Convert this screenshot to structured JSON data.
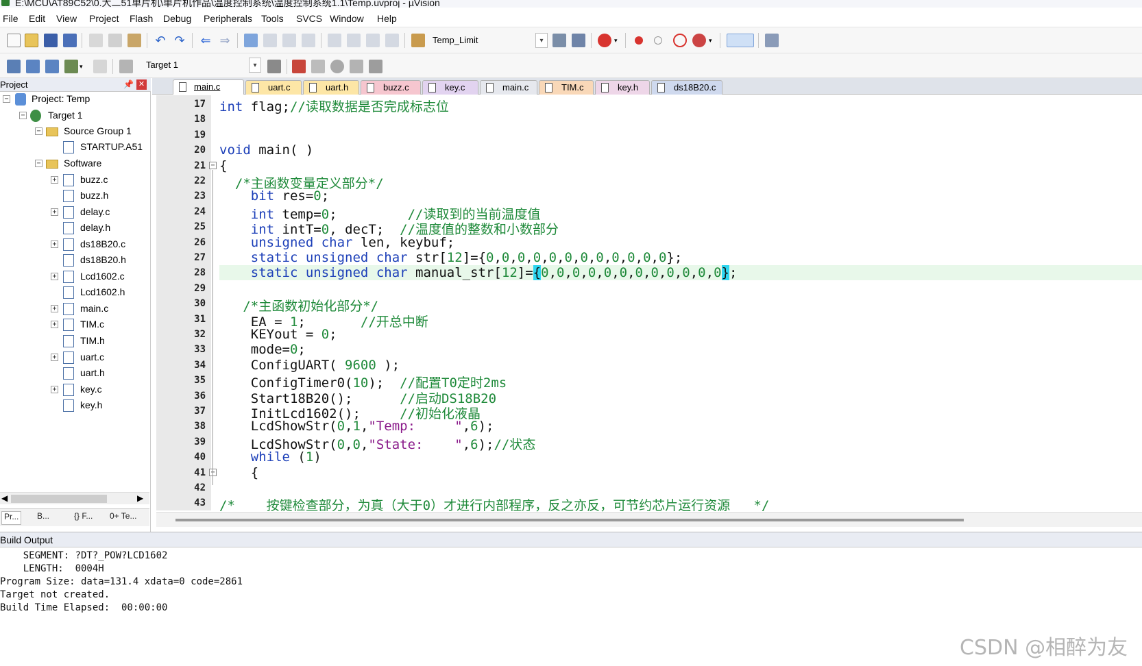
{
  "window": {
    "title": "E:\\MCU\\AT89C52\\0.大二51单片机\\单片机作品\\温度控制系统\\温度控制系统1.1\\Temp.uvproj - µVision"
  },
  "menu": [
    "File",
    "Edit",
    "View",
    "Project",
    "Flash",
    "Debug",
    "Peripherals",
    "Tools",
    "SVCS",
    "Window",
    "Help"
  ],
  "toolbar": {
    "find_combo": "Temp_Limit",
    "target_combo": "Target 1"
  },
  "project_panel": {
    "title": "Project",
    "pin_glyph": "📌",
    "close_glyph": "✕",
    "tree": [
      {
        "label": "Project: Temp",
        "kind": "project"
      },
      {
        "label": "Target 1",
        "kind": "target"
      },
      {
        "label": "Source Group 1",
        "kind": "folder"
      },
      {
        "label": "STARTUP.A51",
        "kind": "file"
      },
      {
        "label": "Software",
        "kind": "folder"
      },
      {
        "label": "buzz.c",
        "kind": "file"
      },
      {
        "label": "buzz.h",
        "kind": "file"
      },
      {
        "label": "delay.c",
        "kind": "file"
      },
      {
        "label": "delay.h",
        "kind": "file"
      },
      {
        "label": "ds18B20.c",
        "kind": "file"
      },
      {
        "label": "ds18B20.h",
        "kind": "file"
      },
      {
        "label": "Lcd1602.c",
        "kind": "file"
      },
      {
        "label": "Lcd1602.h",
        "kind": "file"
      },
      {
        "label": "main.c",
        "kind": "file"
      },
      {
        "label": "TIM.c",
        "kind": "file"
      },
      {
        "label": "TIM.h",
        "kind": "file"
      },
      {
        "label": "uart.c",
        "kind": "file"
      },
      {
        "label": "uart.h",
        "kind": "file"
      },
      {
        "label": "key.c",
        "kind": "file"
      },
      {
        "label": "key.h",
        "kind": "file"
      }
    ],
    "tabs": [
      "Pr...",
      "B...",
      "{} F...",
      "0+ Te..."
    ]
  },
  "editor_tabs": [
    {
      "label": "main.c",
      "color": "#ffffff",
      "active": true
    },
    {
      "label": "uart.c",
      "color": "#fde6a6"
    },
    {
      "label": "uart.h",
      "color": "#fde6a6"
    },
    {
      "label": "buzz.c",
      "color": "#f6c6cf"
    },
    {
      "label": "key.c",
      "color": "#e2d3f0"
    },
    {
      "label": "main.c",
      "color": "#e6e8ee"
    },
    {
      "label": "TIM.c",
      "color": "#f9d8b8"
    },
    {
      "label": "key.h",
      "color": "#eed6e8"
    },
    {
      "label": "ds18B20.c",
      "color": "#cfd9ee"
    }
  ],
  "code_lines": [
    {
      "n": "17",
      "text": "int flag;//读取数据是否完成标志位"
    },
    {
      "n": "18",
      "text": ""
    },
    {
      "n": "19",
      "text": ""
    },
    {
      "n": "20",
      "text": "void main( )"
    },
    {
      "n": "21",
      "text": "{"
    },
    {
      "n": "22",
      "text": "  /*主函数变量定义部分*/"
    },
    {
      "n": "23",
      "text": "    bit res=0;"
    },
    {
      "n": "24",
      "text": "    int temp=0;         //读取到的当前温度值"
    },
    {
      "n": "25",
      "text": "    int intT=0, decT;  //温度值的整数和小数部分"
    },
    {
      "n": "26",
      "text": "    unsigned char len, keybuf;"
    },
    {
      "n": "27",
      "text": "    static unsigned char str[12]={0,0,0,0,0,0,0,0,0,0,0,0};"
    },
    {
      "n": "28",
      "text": "    static unsigned char manual_str[12]={0,0,0,0,0,0,0,0,0,0,0,0};"
    },
    {
      "n": "29",
      "text": ""
    },
    {
      "n": "30",
      "text": "   /*主函数初始化部分*/"
    },
    {
      "n": "31",
      "text": "    EA = 1;       //开总中断"
    },
    {
      "n": "32",
      "text": "    KEYout = 0;"
    },
    {
      "n": "33",
      "text": "    mode=0;"
    },
    {
      "n": "34",
      "text": "    ConfigUART( 9600 );"
    },
    {
      "n": "35",
      "text": "    ConfigTimer0(10);  //配置T0定时2ms"
    },
    {
      "n": "36",
      "text": "    Start18B20();      //启动DS18B20"
    },
    {
      "n": "37",
      "text": "    InitLcd1602();     //初始化液晶"
    },
    {
      "n": "38",
      "text": "    LcdShowStr(0,1,\"Temp:     \",6);"
    },
    {
      "n": "39",
      "text": "    LcdShowStr(0,0,\"State:    \",6);//状态"
    },
    {
      "n": "40",
      "text": "    while (1)"
    },
    {
      "n": "41",
      "text": "    {"
    },
    {
      "n": "42",
      "text": ""
    },
    {
      "n": "43",
      "text": "/*    按键检查部分，为真（大于0）才进行内部程序，反之亦反，可节约芯片运行资源   */"
    }
  ],
  "build_output": {
    "title": "Build Output",
    "lines": [
      "    SEGMENT: ?DT?_POW?LCD1602",
      "    LENGTH:  0004H",
      "Program Size: data=131.4 xdata=0 code=2861",
      "Target not created.",
      "Build Time Elapsed:  00:00:00"
    ]
  },
  "watermark": "CSDN @相醉为友"
}
